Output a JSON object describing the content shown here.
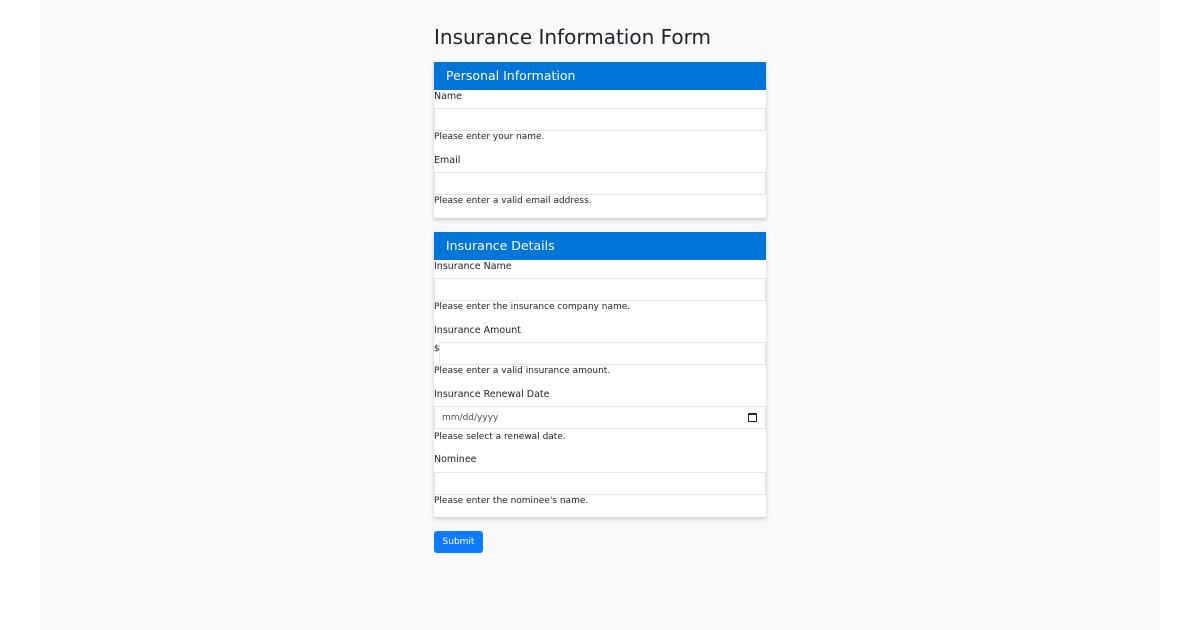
{
  "form": {
    "title": "Insurance Information Form",
    "submit_label": "Submit"
  },
  "personal": {
    "header": "Personal Information",
    "name_label": "Name",
    "name_help": "Please enter your name.",
    "email_label": "Email",
    "email_help": "Please enter a valid email address."
  },
  "insurance": {
    "header": "Insurance Details",
    "company_label": "Insurance Name",
    "company_help": "Please enter the insurance company name.",
    "amount_label": "Insurance Amount",
    "amount_prefix": "$",
    "amount_help": "Please enter a valid insurance amount.",
    "renewal_label": "Insurance Renewal Date",
    "renewal_placeholder": "mm/dd/yyyy",
    "renewal_help": "Please select a renewal date.",
    "nominee_label": "Nominee",
    "nominee_help": "Please enter the nominee's name."
  },
  "colors": {
    "header_bg": "#0275d8",
    "button_bg": "#0d7bfd",
    "page_bg": "#f8f9fa"
  }
}
